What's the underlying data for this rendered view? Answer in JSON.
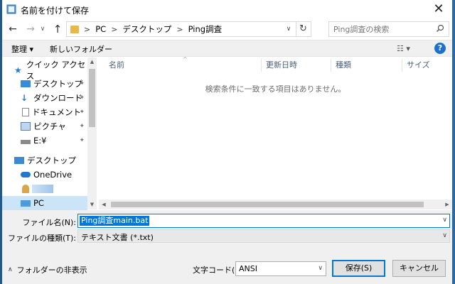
{
  "window": {
    "title": "名前を付けて保存",
    "close_glyph": "✕"
  },
  "nav": {
    "back": "←",
    "forward": "→",
    "recent": "∨",
    "up": "↑"
  },
  "address": {
    "crumbs": [
      "PC",
      "デスクトップ",
      "Ping調査"
    ],
    "separator": ">",
    "dropdown": "∨",
    "refresh": "↻"
  },
  "search": {
    "placeholder": "Ping調査の検索",
    "icon": "search-icon"
  },
  "toolbar": {
    "organize": "整理 ▾",
    "new_folder": "新しいフォルダー",
    "view": "☷ ▾",
    "help": "?"
  },
  "sidebar": {
    "items": [
      {
        "label": "クイック アクセス",
        "icon": "star-icon",
        "pinned": false
      },
      {
        "label": "デスクトップ",
        "icon": "desktop-icon",
        "pinned": true
      },
      {
        "label": "ダウンロード",
        "icon": "download-icon",
        "pinned": true
      },
      {
        "label": "ドキュメント",
        "icon": "document-icon",
        "pinned": true
      },
      {
        "label": "ピクチャ",
        "icon": "picture-icon",
        "pinned": true
      },
      {
        "label": "E:¥",
        "icon": "drive-icon",
        "pinned": true
      },
      {
        "label": "デスクトップ",
        "icon": "desktop-icon",
        "pinned": false
      },
      {
        "label": "OneDrive",
        "icon": "cloud-icon",
        "pinned": false
      },
      {
        "label": "",
        "icon": "user-icon",
        "pinned": false
      },
      {
        "label": "PC",
        "icon": "pc-icon",
        "pinned": false,
        "selected": true
      }
    ],
    "pin_glyph": "📌"
  },
  "filelist": {
    "columns": [
      "名前",
      "更新日時",
      "種類",
      "サイズ"
    ],
    "sort_glyph": "^",
    "empty_message": "検索条件に一致する項目はありません。"
  },
  "form": {
    "filename_label": "ファイル名(N):",
    "filename_value": "Ping調査main.bat",
    "filetype_label": "ファイルの種類(T):",
    "filetype_value": "テキスト文書 (*.txt)",
    "dropdown": "∨"
  },
  "footer": {
    "hide_folders": "フォルダーの非表示",
    "hide_chevron": "∧",
    "encoding_label": "文字コード(E):",
    "encoding_value": "ANSI",
    "save": "保存(S)",
    "cancel": "キャンセル"
  },
  "colors": {
    "accent": "#0078d7",
    "selected_nav": "#cce4f7",
    "toolbar_bg": "#f0f0f0",
    "folder": "#e8b94a"
  }
}
